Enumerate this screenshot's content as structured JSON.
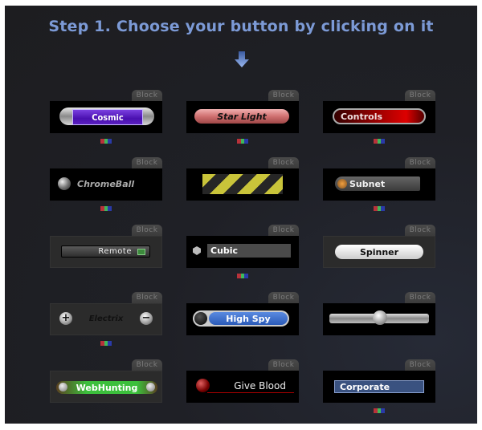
{
  "header": {
    "title": "Step 1. Choose your button by clicking on it",
    "arrow_icon": "arrow-down-icon"
  },
  "colors": {
    "title": "#7c9ad6",
    "background": "#1f2026"
  },
  "tiles": [
    {
      "label": "Cosmic",
      "tab": "Block",
      "color_options": true
    },
    {
      "label": "Star Light",
      "tab": "Block",
      "color_options": true
    },
    {
      "label": "Controls",
      "tab": "Block",
      "color_options": true
    },
    {
      "label": "ChromeBall",
      "tab": "Block",
      "color_options": true
    },
    {
      "label": "",
      "tab": "Block",
      "color_options": false
    },
    {
      "label": "Subnet",
      "tab": "Block",
      "color_options": true
    },
    {
      "label": "Remote",
      "tab": "Block",
      "color_options": false
    },
    {
      "label": "Cubic",
      "tab": "Block",
      "color_options": true
    },
    {
      "label": "Spinner",
      "tab": "Block",
      "color_options": false
    },
    {
      "label": "Electrix",
      "tab": "Block",
      "color_options": true,
      "plus": "+",
      "minus": "−"
    },
    {
      "label": "High Spy",
      "tab": "Block",
      "color_options": false
    },
    {
      "label": "",
      "tab": "Block",
      "color_options": false
    },
    {
      "label": "WebHunting",
      "tab": "Block",
      "color_options": false
    },
    {
      "label": "Give Blood",
      "tab": "Block",
      "color_options": false
    },
    {
      "label": "Corporate",
      "tab": "Block",
      "color_options": true
    }
  ]
}
